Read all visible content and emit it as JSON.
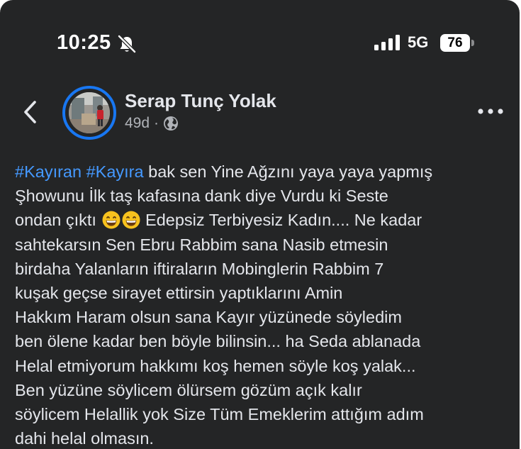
{
  "status_bar": {
    "time": "10:25",
    "silent_icon": "bell-slash-icon",
    "signal_icon": "cellular-signal-icon",
    "network": "5G",
    "battery": "76"
  },
  "header": {
    "back_icon": "chevron-left-icon",
    "author": "Serap Tunç Yolak",
    "age": "49d",
    "separator": "·",
    "privacy_icon": "globe-icon",
    "more_icon": "more-dots-icon"
  },
  "post": {
    "hashtags": [
      "#Kayıran",
      "#Kayıra"
    ],
    "text_part1": " bak sen Yine Ağzını yaya yaya yapmış\nŞhowunu İlk taş kafasına dank diye Vurdu ki Seste\nondan çıktı ",
    "emojis": [
      "grinning-face-emoji",
      "grinning-face-emoji"
    ],
    "text_part2": "  Edepsiz Terbiyesiz Kadın.... Ne kadar\nsahtekarsın Sen Ebru Rabbim sana Nasib etmesin\nbirdaha Yalanların iftiraların Mobinglerin Rabbim 7\nkuşak geçse sirayet ettirsin yaptıklarını Amin\n Hakkım Haram olsun sana  Kayır yüzünede söyledim\nben ölene kadar ben böyle bilinsin... ha Seda ablanada\nHelal etmiyorum hakkımı koş hemen söyle koş yalak...\nBen yüzüne söylicem ölürsem gözüm açık kalır\nsöylicem Helallik yok Size Tüm Emeklerim attığım adım\ndahi helal olmasın."
  },
  "colors": {
    "background": "#242526",
    "text": "#e4e6eb",
    "secondary_text": "#b0b3b8",
    "hashtag": "#4599ff",
    "avatar_ring": "#1877f2"
  }
}
